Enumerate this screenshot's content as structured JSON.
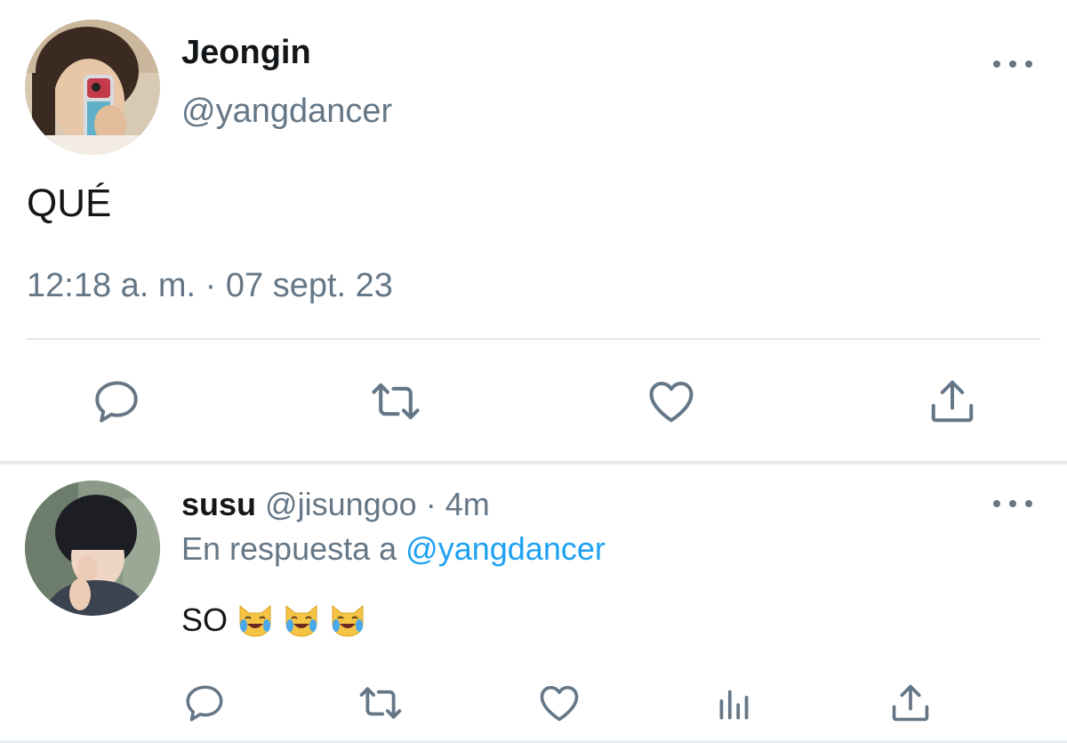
{
  "main_tweet": {
    "display_name": "Jeongin",
    "handle": "@yangdancer",
    "text": "QUÉ",
    "timestamp": "12:18 a. m. · 07 sept. 23",
    "actions": [
      "reply-icon",
      "retweet-icon",
      "like-icon",
      "share-icon"
    ]
  },
  "reply_tweet": {
    "display_name": "susu",
    "handle": "@jisungoo",
    "separator": "·",
    "age": "4m",
    "context_prefix": "En respuesta a",
    "context_mention": "@yangdancer",
    "text": "SO",
    "emojis": [
      "cat-tears-of-joy-icon",
      "cat-tears-of-joy-icon",
      "cat-tears-of-joy-icon"
    ],
    "actions": [
      "reply-icon",
      "retweet-icon",
      "like-icon",
      "stats-icon",
      "share-icon"
    ]
  },
  "colors": {
    "text_primary": "#14171a",
    "text_secondary": "#657786",
    "link": "#1da1f2",
    "divider": "#e1e8ed",
    "icon": "#657786"
  }
}
